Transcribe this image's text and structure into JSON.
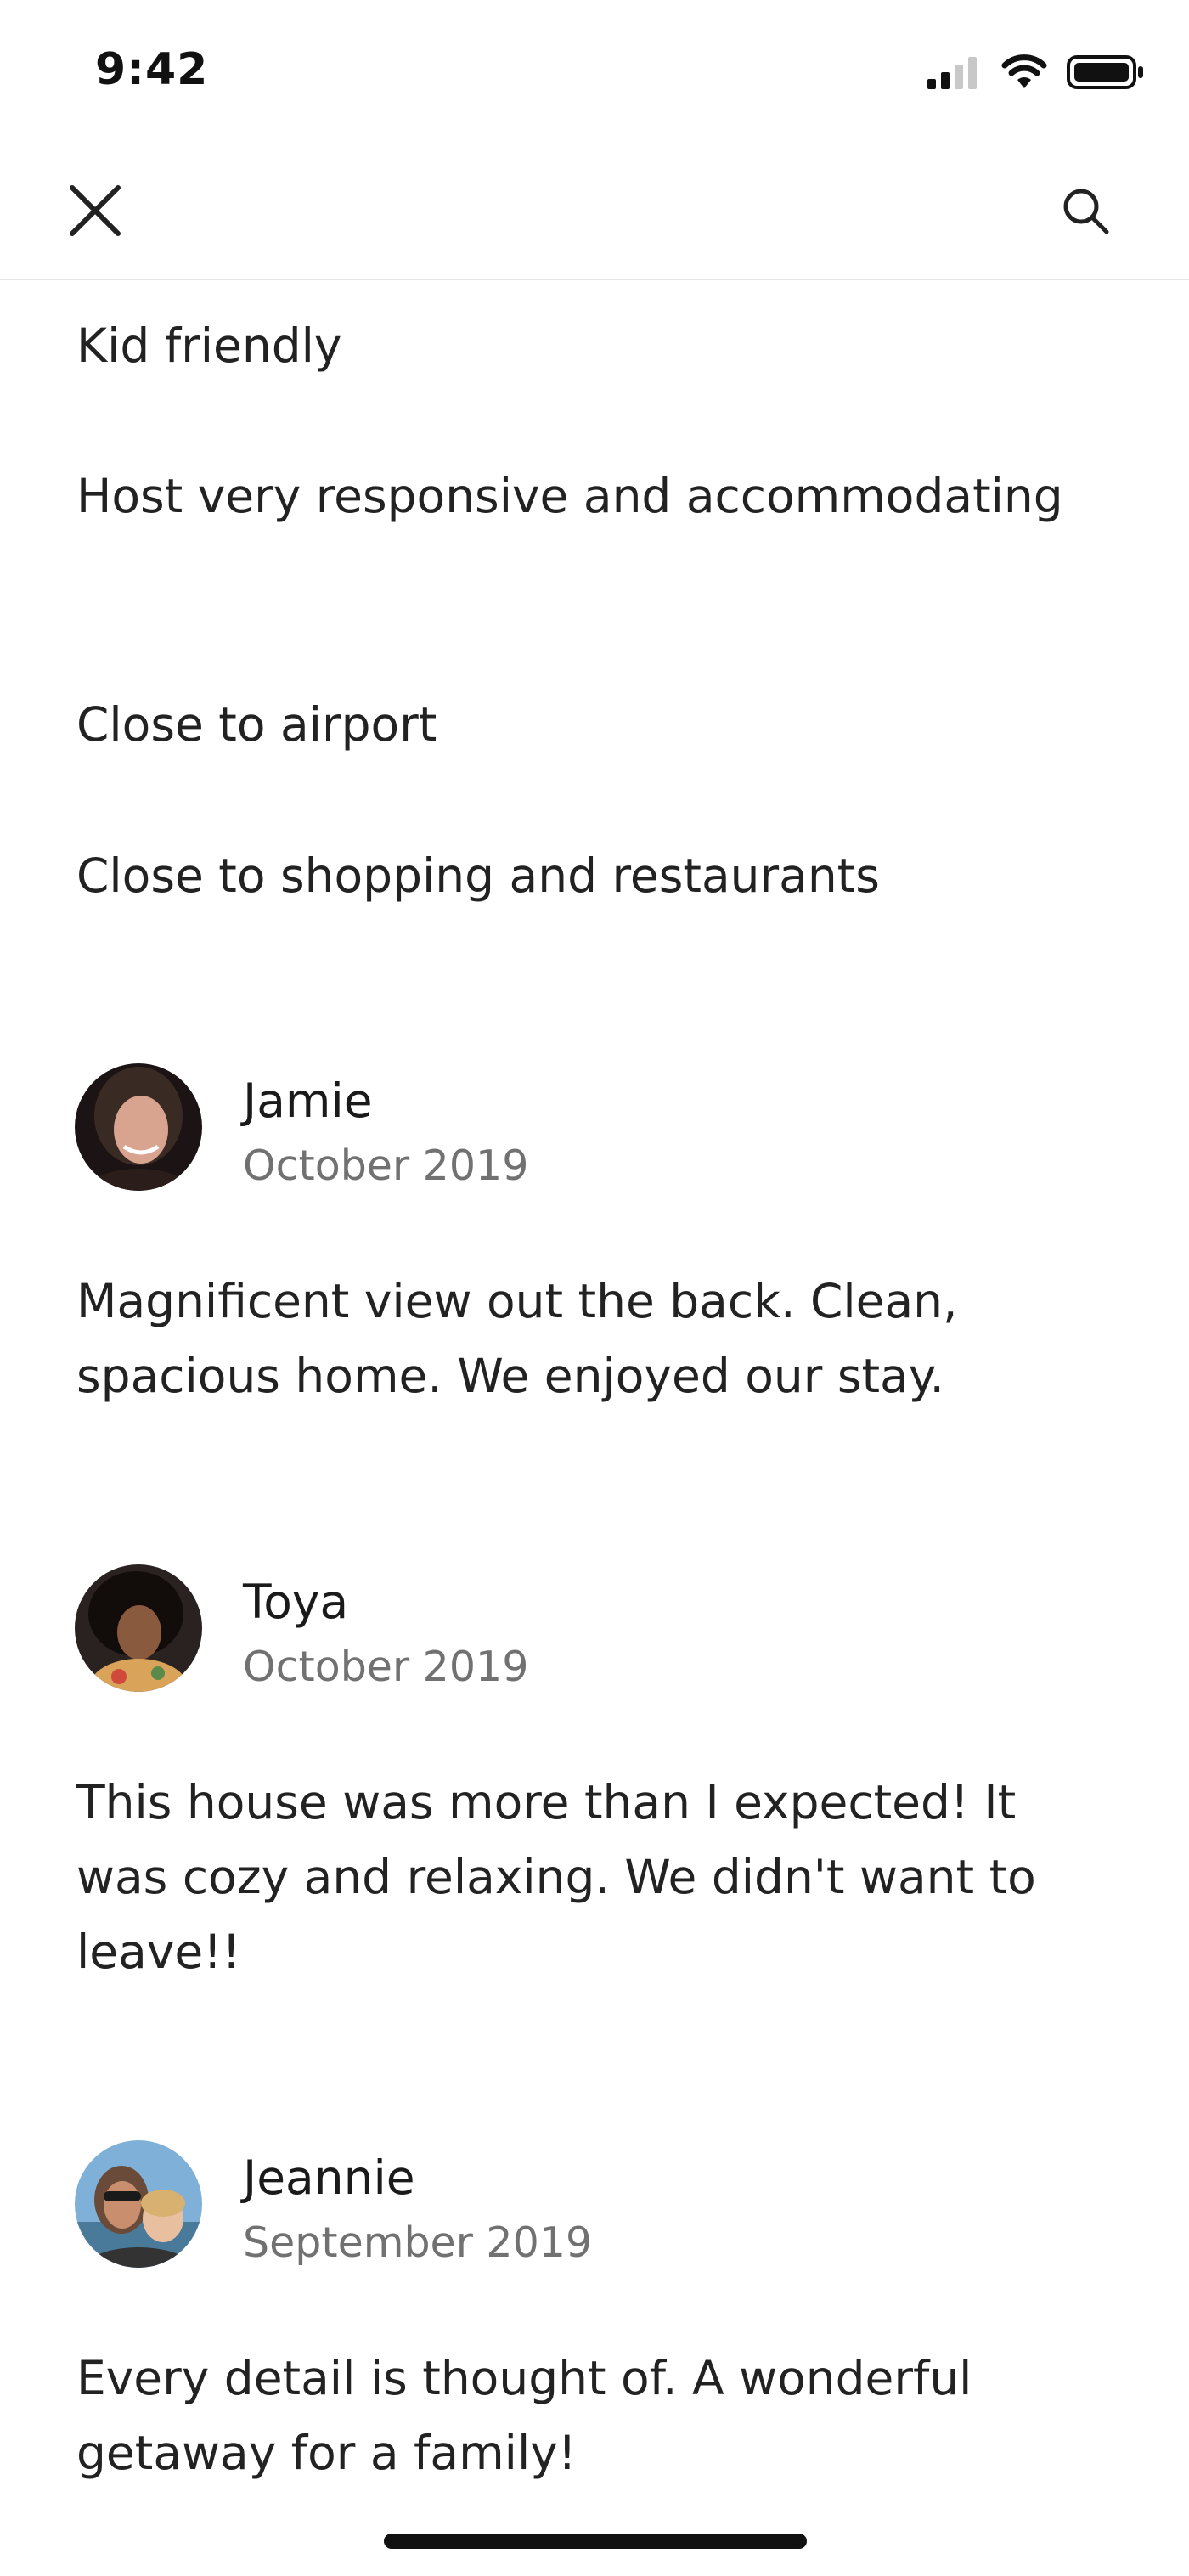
{
  "status_bar": {
    "time": "9:42",
    "icons": [
      "cellular-signal-icon",
      "wifi-icon",
      "battery-icon"
    ]
  },
  "nav": {
    "close_icon": "close-icon",
    "search_icon": "search-icon"
  },
  "highlights": [
    "Kid friendly",
    "Host very responsive and accommodating",
    "Close to airport",
    "Close to shopping and restaurants"
  ],
  "reviews": [
    {
      "name": "Jamie",
      "date": "October 2019",
      "text": "Magnificent view out the back. Clean, spacious home. We enjoyed our stay."
    },
    {
      "name": "Toya",
      "date": "October 2019",
      "text": "This house was more than I expected! It was cozy and relaxing. We didn't want to leave!!"
    },
    {
      "name": "Jeannie",
      "date": "September 2019",
      "text": "Every detail is thought of. A wonderful getaway for a family!"
    }
  ],
  "colors": {
    "text_primary": "#222222",
    "text_secondary": "#717171",
    "divider": "#e6e6e6"
  }
}
